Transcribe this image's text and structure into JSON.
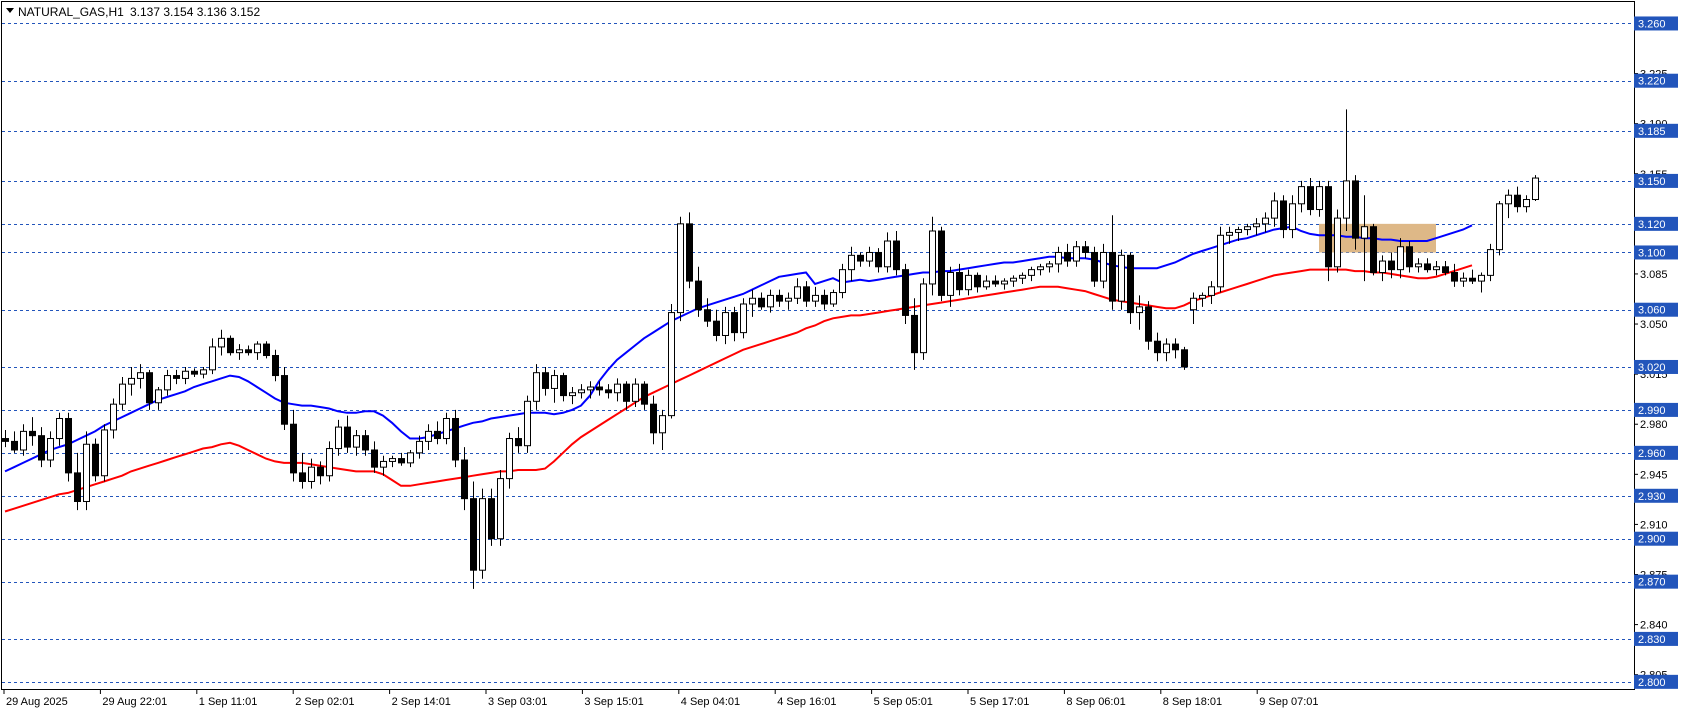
{
  "chart_data": {
    "type": "candlestick",
    "header": {
      "symbol": "NATURAL_GAS,H1",
      "ohlc": "3.137 3.154 3.136 3.152"
    },
    "ylim": [
      2.795,
      3.275
    ],
    "y_tick_labels": [
      "2.805",
      "2.840",
      "2.875",
      "2.910",
      "2.945",
      "2.980",
      "3.015",
      "3.050",
      "3.085",
      "3.120",
      "3.155",
      "3.190",
      "3.225"
    ],
    "level_lines": [
      "2.800",
      "2.830",
      "2.870",
      "2.900",
      "2.930",
      "2.960",
      "2.990",
      "3.020",
      "3.060",
      "3.100",
      "3.120",
      "3.150",
      "3.185",
      "3.220",
      "3.260"
    ],
    "x_tick_labels": [
      "29 Aug 2025",
      "29 Aug 22:01",
      "1 Sep 11:01",
      "2 Sep 02:01",
      "2 Sep 14:01",
      "3 Sep 03:01",
      "3 Sep 15:01",
      "4 Sep 04:01",
      "4 Sep 16:01",
      "5 Sep 05:01",
      "5 Sep 17:01",
      "8 Sep 06:01",
      "8 Sep 18:01",
      "9 Sep 07:01"
    ],
    "zone": {
      "from": 3.1,
      "to": 3.12,
      "color": "#DEB887"
    },
    "ma_series": [
      {
        "color": "#0000FF",
        "values": [
          2.947,
          2.95,
          2.953,
          2.956,
          2.959,
          2.962,
          2.964,
          2.966,
          2.969,
          2.972,
          2.975,
          2.979,
          2.982,
          2.985,
          2.988,
          2.991,
          2.994,
          2.997,
          2.999,
          3.001,
          3.003,
          3.006,
          3.008,
          3.01,
          3.012,
          3.014,
          3.013,
          3.01,
          3.006,
          3.002,
          2.998,
          2.995,
          2.994,
          2.993,
          2.993,
          2.992,
          2.991,
          2.989,
          2.988,
          2.988,
          2.989,
          2.989,
          2.986,
          2.981,
          2.975,
          2.97,
          2.97,
          2.971,
          2.973,
          2.975,
          2.977,
          2.979,
          2.981,
          2.982,
          2.984,
          2.985,
          2.986,
          2.987,
          2.988,
          2.988,
          2.988,
          2.987,
          2.988,
          2.99,
          2.993,
          3.0,
          3.01,
          3.018,
          3.025,
          3.03,
          3.035,
          3.04,
          3.044,
          3.048,
          3.052,
          3.055,
          3.058,
          3.061,
          3.063,
          3.065,
          3.067,
          3.069,
          3.071,
          3.074,
          3.077,
          3.08,
          3.083,
          3.084,
          3.085,
          3.086,
          3.078,
          3.08,
          3.082,
          3.079,
          3.08,
          3.081,
          3.08,
          3.081,
          3.082,
          3.083,
          3.084,
          3.085,
          3.086,
          3.086,
          3.087,
          3.087,
          3.088,
          3.089,
          3.09,
          3.091,
          3.092,
          3.093,
          3.093,
          3.094,
          3.095,
          3.096,
          3.097,
          3.097,
          3.096,
          3.096,
          3.096,
          3.095,
          3.093,
          3.091,
          3.09,
          3.089,
          3.089,
          3.089,
          3.089,
          3.091,
          3.093,
          3.096,
          3.099,
          3.101,
          3.103,
          3.105,
          3.107,
          3.109,
          3.11,
          3.112,
          3.114,
          3.116,
          3.117,
          3.118,
          3.115,
          3.113,
          3.112,
          3.112,
          3.112,
          3.111,
          3.111,
          3.11,
          3.11,
          3.109,
          3.109,
          3.108,
          3.108,
          3.108,
          3.108,
          3.11,
          3.112,
          3.114,
          3.116,
          3.119
        ]
      },
      {
        "color": "#FF0000",
        "values": [
          2.919,
          2.921,
          2.923,
          2.925,
          2.927,
          2.929,
          2.931,
          2.932,
          2.934,
          2.936,
          2.938,
          2.94,
          2.942,
          2.944,
          2.947,
          2.949,
          2.951,
          2.953,
          2.955,
          2.957,
          2.959,
          2.961,
          2.963,
          2.964,
          2.966,
          2.967,
          2.965,
          2.962,
          2.959,
          2.956,
          2.954,
          2.953,
          2.953,
          2.953,
          2.952,
          2.951,
          2.95,
          2.949,
          2.948,
          2.947,
          2.947,
          2.947,
          2.945,
          2.941,
          2.937,
          2.937,
          2.938,
          2.939,
          2.94,
          2.941,
          2.942,
          2.943,
          2.944,
          2.945,
          2.946,
          2.947,
          2.947,
          2.948,
          2.948,
          2.948,
          2.949,
          2.954,
          2.96,
          2.966,
          2.971,
          2.975,
          2.979,
          2.983,
          2.987,
          2.991,
          2.995,
          2.999,
          3.002,
          3.005,
          3.008,
          3.011,
          3.014,
          3.017,
          3.02,
          3.023,
          3.026,
          3.029,
          3.032,
          3.034,
          3.036,
          3.038,
          3.04,
          3.042,
          3.044,
          3.047,
          3.049,
          3.052,
          3.054,
          3.055,
          3.056,
          3.056,
          3.057,
          3.058,
          3.059,
          3.06,
          3.061,
          3.062,
          3.063,
          3.064,
          3.065,
          3.066,
          3.067,
          3.068,
          3.069,
          3.07,
          3.071,
          3.072,
          3.073,
          3.074,
          3.075,
          3.076,
          3.076,
          3.076,
          3.075,
          3.074,
          3.073,
          3.071,
          3.069,
          3.067,
          3.066,
          3.065,
          3.064,
          3.063,
          3.062,
          3.061,
          3.061,
          3.063,
          3.066,
          3.068,
          3.07,
          3.072,
          3.074,
          3.076,
          3.078,
          3.08,
          3.082,
          3.084,
          3.085,
          3.086,
          3.087,
          3.088,
          3.088,
          3.088,
          3.088,
          3.088,
          3.087,
          3.087,
          3.086,
          3.086,
          3.085,
          3.084,
          3.083,
          3.082,
          3.082,
          3.083,
          3.085,
          3.087,
          3.089,
          3.091
        ]
      }
    ],
    "candles": [
      [
        2.97,
        2.976,
        2.964,
        2.968
      ],
      [
        2.968,
        2.975,
        2.96,
        2.962
      ],
      [
        2.962,
        2.98,
        2.958,
        2.975
      ],
      [
        2.975,
        2.985,
        2.965,
        2.972
      ],
      [
        2.972,
        2.978,
        2.95,
        2.955
      ],
      [
        2.955,
        2.975,
        2.95,
        2.97
      ],
      [
        2.97,
        2.988,
        2.965,
        2.984
      ],
      [
        2.984,
        2.988,
        2.94,
        2.946
      ],
      [
        2.946,
        2.96,
        2.92,
        2.926
      ],
      [
        2.926,
        2.975,
        2.92,
        2.966
      ],
      [
        2.966,
        2.97,
        2.94,
        2.944
      ],
      [
        2.944,
        2.98,
        2.94,
        2.976
      ],
      [
        2.976,
        2.998,
        2.97,
        2.994
      ],
      [
        2.994,
        3.013,
        2.99,
        3.008
      ],
      [
        3.008,
        3.02,
        3.0,
        3.012
      ],
      [
        3.012,
        3.022,
        3.005,
        3.016
      ],
      [
        3.016,
        3.018,
        2.99,
        2.995
      ],
      [
        2.995,
        3.006,
        2.99,
        3.004
      ],
      [
        3.004,
        3.018,
        3.0,
        3.014
      ],
      [
        3.014,
        3.018,
        3.008,
        3.012
      ],
      [
        3.012,
        3.02,
        3.008,
        3.017
      ],
      [
        3.017,
        3.019,
        3.013,
        3.015
      ],
      [
        3.015,
        3.02,
        3.012,
        3.018
      ],
      [
        3.018,
        3.04,
        3.015,
        3.034
      ],
      [
        3.034,
        3.046,
        3.028,
        3.04
      ],
      [
        3.04,
        3.042,
        3.028,
        3.03
      ],
      [
        3.03,
        3.036,
        3.025,
        3.032
      ],
      [
        3.032,
        3.035,
        3.028,
        3.03
      ],
      [
        3.03,
        3.038,
        3.025,
        3.036
      ],
      [
        3.036,
        3.038,
        3.026,
        3.028
      ],
      [
        3.028,
        3.032,
        3.01,
        3.014
      ],
      [
        3.014,
        3.02,
        2.976,
        2.98
      ],
      [
        2.98,
        2.99,
        2.94,
        2.946
      ],
      [
        2.946,
        2.96,
        2.935,
        2.94
      ],
      [
        2.94,
        2.956,
        2.935,
        2.95
      ],
      [
        2.95,
        2.954,
        2.938,
        2.944
      ],
      [
        2.944,
        2.968,
        2.94,
        2.963
      ],
      [
        2.963,
        2.983,
        2.958,
        2.978
      ],
      [
        2.978,
        2.986,
        2.96,
        2.964
      ],
      [
        2.964,
        2.976,
        2.958,
        2.972
      ],
      [
        2.972,
        2.976,
        2.958,
        2.962
      ],
      [
        2.962,
        2.968,
        2.946,
        2.95
      ],
      [
        2.95,
        2.958,
        2.944,
        2.954
      ],
      [
        2.954,
        2.958,
        2.95,
        2.956
      ],
      [
        2.956,
        2.96,
        2.951,
        2.953
      ],
      [
        2.953,
        2.962,
        2.95,
        2.96
      ],
      [
        2.96,
        2.972,
        2.956,
        2.968
      ],
      [
        2.968,
        2.98,
        2.962,
        2.975
      ],
      [
        2.975,
        2.982,
        2.966,
        2.97
      ],
      [
        2.97,
        2.988,
        2.966,
        2.984
      ],
      [
        2.984,
        2.99,
        2.95,
        2.955
      ],
      [
        2.955,
        2.964,
        2.92,
        2.928
      ],
      [
        2.928,
        2.94,
        2.865,
        2.878
      ],
      [
        2.878,
        2.935,
        2.872,
        2.928
      ],
      [
        2.928,
        2.935,
        2.895,
        2.9
      ],
      [
        2.9,
        2.948,
        2.895,
        2.942
      ],
      [
        2.942,
        2.974,
        2.935,
        2.97
      ],
      [
        2.97,
        2.978,
        2.96,
        2.965
      ],
      [
        2.965,
        3.0,
        2.96,
        2.996
      ],
      [
        2.996,
        3.022,
        2.99,
        3.016
      ],
      [
        3.016,
        3.02,
        3.0,
        3.005
      ],
      [
        3.005,
        3.018,
        2.995,
        3.014
      ],
      [
        3.014,
        3.016,
        2.996,
        3.0
      ],
      [
        3.0,
        3.006,
        2.994,
        3.002
      ],
      [
        3.002,
        3.008,
        2.998,
        3.004
      ],
      [
        3.004,
        3.01,
        2.998,
        3.006
      ],
      [
        3.006,
        3.01,
        3.0,
        3.004
      ],
      [
        3.004,
        3.008,
        2.998,
        3.002
      ],
      [
        3.002,
        3.012,
        2.996,
        3.008
      ],
      [
        3.008,
        3.01,
        2.99,
        2.996
      ],
      [
        2.996,
        3.012,
        2.992,
        3.008
      ],
      [
        3.008,
        3.01,
        2.99,
        2.994
      ],
      [
        2.994,
        3.0,
        2.966,
        2.974
      ],
      [
        2.974,
        2.99,
        2.962,
        2.986
      ],
      [
        2.986,
        3.064,
        2.984,
        3.058
      ],
      [
        3.058,
        3.125,
        3.052,
        3.12
      ],
      [
        3.12,
        3.128,
        3.075,
        3.08
      ],
      [
        3.08,
        3.09,
        3.055,
        3.06
      ],
      [
        3.06,
        3.068,
        3.048,
        3.052
      ],
      [
        3.052,
        3.06,
        3.038,
        3.042
      ],
      [
        3.042,
        3.062,
        3.036,
        3.058
      ],
      [
        3.058,
        3.062,
        3.038,
        3.044
      ],
      [
        3.044,
        3.068,
        3.04,
        3.064
      ],
      [
        3.064,
        3.074,
        3.055,
        3.068
      ],
      [
        3.068,
        3.072,
        3.06,
        3.062
      ],
      [
        3.062,
        3.074,
        3.058,
        3.07
      ],
      [
        3.07,
        3.074,
        3.062,
        3.066
      ],
      [
        3.066,
        3.072,
        3.06,
        3.068
      ],
      [
        3.068,
        3.082,
        3.064,
        3.076
      ],
      [
        3.076,
        3.08,
        3.062,
        3.066
      ],
      [
        3.066,
        3.076,
        3.062,
        3.07
      ],
      [
        3.07,
        3.074,
        3.06,
        3.064
      ],
      [
        3.064,
        3.074,
        3.062,
        3.072
      ],
      [
        3.072,
        3.092,
        3.068,
        3.088
      ],
      [
        3.088,
        3.104,
        3.08,
        3.098
      ],
      [
        3.098,
        3.1,
        3.09,
        3.094
      ],
      [
        3.094,
        3.104,
        3.09,
        3.1
      ],
      [
        3.1,
        3.103,
        3.086,
        3.09
      ],
      [
        3.09,
        3.114,
        3.086,
        3.108
      ],
      [
        3.108,
        3.115,
        3.084,
        3.088
      ],
      [
        3.088,
        3.092,
        3.05,
        3.056
      ],
      [
        3.056,
        3.068,
        3.018,
        3.03
      ],
      [
        3.03,
        3.082,
        3.025,
        3.078
      ],
      [
        3.078,
        3.125,
        3.07,
        3.115
      ],
      [
        3.115,
        3.118,
        3.066,
        3.07
      ],
      [
        3.07,
        3.09,
        3.062,
        3.086
      ],
      [
        3.086,
        3.092,
        3.07,
        3.074
      ],
      [
        3.074,
        3.088,
        3.07,
        3.084
      ],
      [
        3.084,
        3.086,
        3.072,
        3.076
      ],
      [
        3.076,
        3.084,
        3.074,
        3.08
      ],
      [
        3.08,
        3.084,
        3.076,
        3.078
      ],
      [
        3.078,
        3.082,
        3.074,
        3.08
      ],
      [
        3.08,
        3.084,
        3.076,
        3.082
      ],
      [
        3.082,
        3.086,
        3.078,
        3.084
      ],
      [
        3.084,
        3.09,
        3.08,
        3.088
      ],
      [
        3.088,
        3.092,
        3.084,
        3.09
      ],
      [
        3.09,
        3.094,
        3.086,
        3.092
      ],
      [
        3.092,
        3.104,
        3.086,
        3.1
      ],
      [
        3.1,
        3.106,
        3.09,
        3.094
      ],
      [
        3.094,
        3.108,
        3.09,
        3.104
      ],
      [
        3.104,
        3.108,
        3.096,
        3.1
      ],
      [
        3.1,
        3.104,
        3.076,
        3.08
      ],
      [
        3.08,
        3.106,
        3.075,
        3.1
      ],
      [
        3.1,
        3.126,
        3.06,
        3.066
      ],
      [
        3.066,
        3.102,
        3.06,
        3.098
      ],
      [
        3.098,
        3.1,
        3.05,
        3.058
      ],
      [
        3.058,
        3.07,
        3.046,
        3.062
      ],
      [
        3.062,
        3.066,
        3.032,
        3.038
      ],
      [
        3.038,
        3.044,
        3.024,
        3.03
      ],
      [
        3.03,
        3.04,
        3.024,
        3.036
      ],
      [
        3.036,
        3.04,
        3.026,
        3.032
      ],
      [
        3.032,
        3.034,
        3.018,
        3.02
      ],
      [
        3.06,
        3.072,
        3.05,
        3.068
      ],
      [
        3.068,
        3.072,
        3.062,
        3.07
      ],
      [
        3.07,
        3.08,
        3.064,
        3.076
      ],
      [
        3.076,
        3.118,
        3.072,
        3.112
      ],
      [
        3.112,
        3.118,
        3.106,
        3.114
      ],
      [
        3.114,
        3.118,
        3.108,
        3.116
      ],
      [
        3.116,
        3.12,
        3.112,
        3.118
      ],
      [
        3.118,
        3.124,
        3.112,
        3.12
      ],
      [
        3.12,
        3.128,
        3.114,
        3.124
      ],
      [
        3.124,
        3.142,
        3.118,
        3.136
      ],
      [
        3.136,
        3.14,
        3.11,
        3.116
      ],
      [
        3.116,
        3.14,
        3.11,
        3.134
      ],
      [
        3.134,
        3.15,
        3.128,
        3.146
      ],
      [
        3.146,
        3.152,
        3.126,
        3.13
      ],
      [
        3.13,
        3.15,
        3.125,
        3.146
      ],
      [
        3.146,
        3.15,
        3.08,
        3.09
      ],
      [
        3.09,
        3.13,
        3.086,
        3.124
      ],
      [
        3.124,
        3.2,
        3.115,
        3.15
      ],
      [
        3.15,
        3.154,
        3.102,
        3.11
      ],
      [
        3.11,
        3.14,
        3.08,
        3.118
      ],
      [
        3.118,
        3.12,
        3.084,
        3.086
      ],
      [
        3.086,
        3.098,
        3.08,
        3.094
      ],
      [
        3.094,
        3.1,
        3.082,
        3.088
      ],
      [
        3.088,
        3.11,
        3.082,
        3.104
      ],
      [
        3.104,
        3.108,
        3.086,
        3.09
      ],
      [
        3.09,
        3.096,
        3.086,
        3.092
      ],
      [
        3.092,
        3.096,
        3.086,
        3.088
      ],
      [
        3.088,
        3.094,
        3.084,
        3.09
      ],
      [
        3.09,
        3.094,
        3.084,
        3.086
      ],
      [
        3.086,
        3.092,
        3.076,
        3.08
      ],
      [
        3.08,
        3.086,
        3.076,
        3.082
      ],
      [
        3.082,
        3.088,
        3.078,
        3.08
      ],
      [
        3.08,
        3.086,
        3.072,
        3.084
      ],
      [
        3.084,
        3.106,
        3.08,
        3.102
      ],
      [
        3.102,
        3.136,
        3.098,
        3.134
      ],
      [
        3.134,
        3.144,
        3.124,
        3.14
      ],
      [
        3.14,
        3.146,
        3.128,
        3.132
      ],
      [
        3.132,
        3.14,
        3.128,
        3.137
      ],
      [
        3.137,
        3.154,
        3.136,
        3.152
      ]
    ]
  }
}
